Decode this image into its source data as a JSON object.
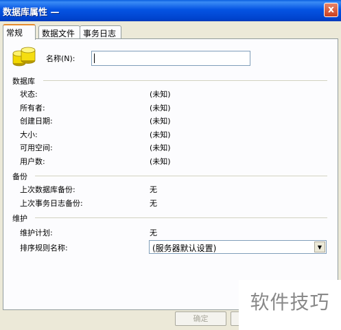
{
  "window": {
    "title": "数据库属性 —",
    "close_label": "x"
  },
  "tabs": [
    {
      "label": "常规"
    },
    {
      "label": "数据文件"
    },
    {
      "label": "事务日志"
    }
  ],
  "general": {
    "name_label": "名称(N):",
    "name_value": ""
  },
  "database_section": {
    "title": "数据库",
    "rows": [
      {
        "label": "状态:",
        "value": "(未知)"
      },
      {
        "label": "所有者:",
        "value": "(未知)"
      },
      {
        "label": "创建日期:",
        "value": "(未知)"
      },
      {
        "label": "大小:",
        "value": "(未知)"
      },
      {
        "label": "可用空间:",
        "value": "(未知)"
      },
      {
        "label": "用户数:",
        "value": "(未知)"
      }
    ]
  },
  "backup_section": {
    "title": "备份",
    "rows": [
      {
        "label": "上次数据库备份:",
        "value": "无"
      },
      {
        "label": "上次事务日志备份:",
        "value": "无"
      }
    ]
  },
  "maintenance_section": {
    "title": "维护",
    "plan_label": "维护计划:",
    "plan_value": "无",
    "collation_label": "排序规则名称:",
    "collation_value": "(服务器默认设置)"
  },
  "buttons": {
    "ok_label": "确定"
  },
  "watermark": "软件技巧",
  "icons": {
    "database": "database-icon",
    "dropdown": "chevron-down-icon"
  }
}
